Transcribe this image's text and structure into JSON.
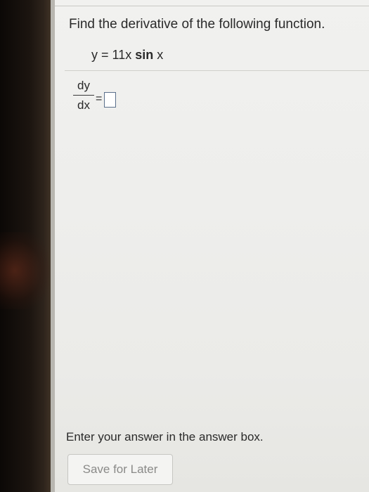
{
  "question": {
    "prompt": "Find the derivative of the following function.",
    "equation": {
      "lhs": "y = 11x",
      "func": "sin",
      "arg": "x"
    }
  },
  "answer": {
    "numerator": "dy",
    "denominator": "dx",
    "equals": "="
  },
  "footer": {
    "instruction": "Enter your answer in the answer box.",
    "save_label": "Save for Later"
  }
}
